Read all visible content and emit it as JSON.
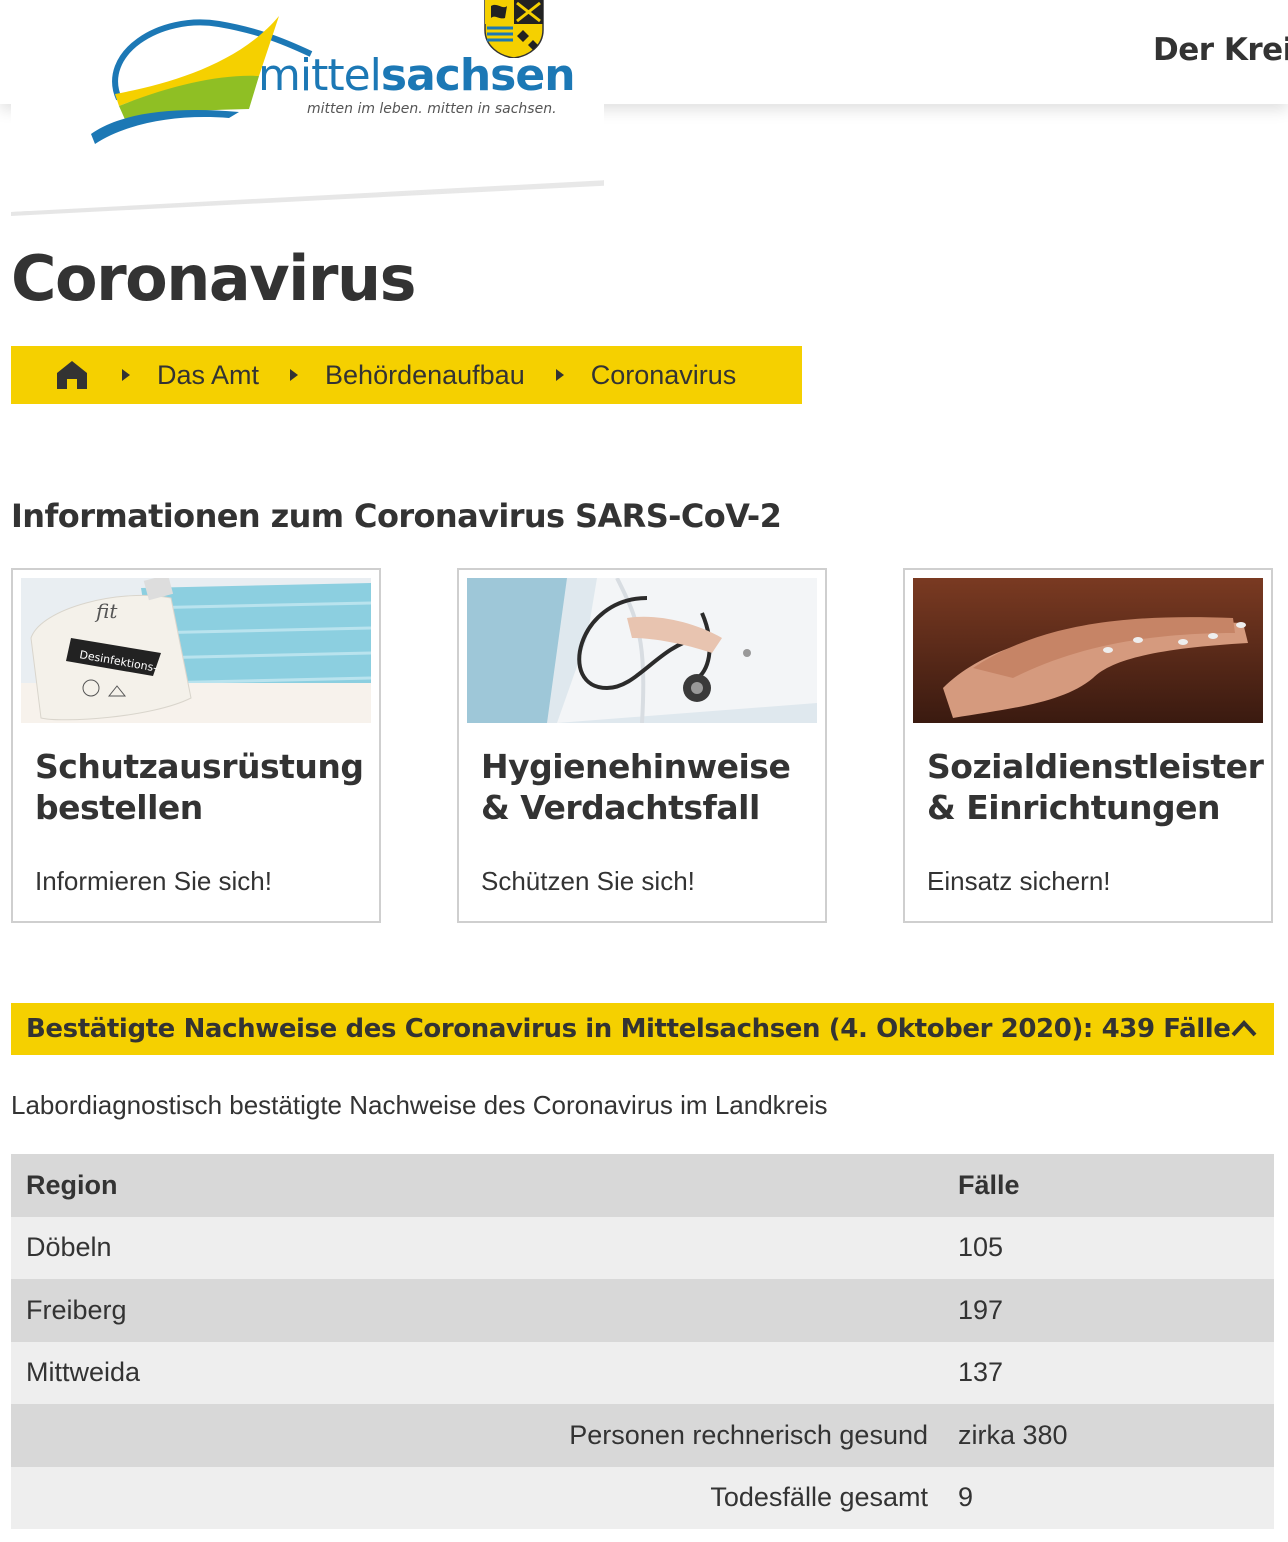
{
  "header": {
    "logo": {
      "text_light": "mittel",
      "text_bold": "sachsen",
      "tagline": "mitten im leben. mitten in sachsen."
    },
    "nav_link": "Der Kreis"
  },
  "page_title": "Coronavirus",
  "breadcrumb": {
    "home_icon": "home-icon",
    "items": [
      "Das Amt",
      "Behördenaufbau",
      "Coronavirus"
    ]
  },
  "section_title": "Informationen zum Coronavirus SARS-CoV-2",
  "cards": [
    {
      "title": "Schutzausrüstung bestellen",
      "subtitle": "Informieren Sie sich!"
    },
    {
      "title": "Hygienehinweise & Verdachtsfall",
      "subtitle": "Schützen Sie sich!"
    },
    {
      "title": "Sozialdienstleister & Einrichtungen",
      "subtitle": "Einsatz sichern!"
    }
  ],
  "accordion": {
    "title": "Bestätigte Nachweise des Coronavirus in Mittelsachsen (4. Oktober 2020): 439 Fälle",
    "icon": "chevron-up-icon"
  },
  "intro_text": "Labordiagnostisch bestätigte Nachweise des Coronavirus im Landkreis",
  "table": {
    "headers": [
      "Region",
      "Fälle"
    ],
    "rows": [
      [
        "Döbeln",
        "105"
      ],
      [
        "Freiberg",
        "197"
      ],
      [
        "Mittweida",
        "137"
      ]
    ],
    "summary": [
      [
        "Personen rechnerisch gesund",
        "zirka 380"
      ],
      [
        "Todesfälle gesamt",
        "9"
      ]
    ]
  },
  "colors": {
    "accent_yellow": "#f5d000",
    "brand_blue": "#1c78b5",
    "brand_green": "#8fbf24",
    "text": "#333333"
  }
}
